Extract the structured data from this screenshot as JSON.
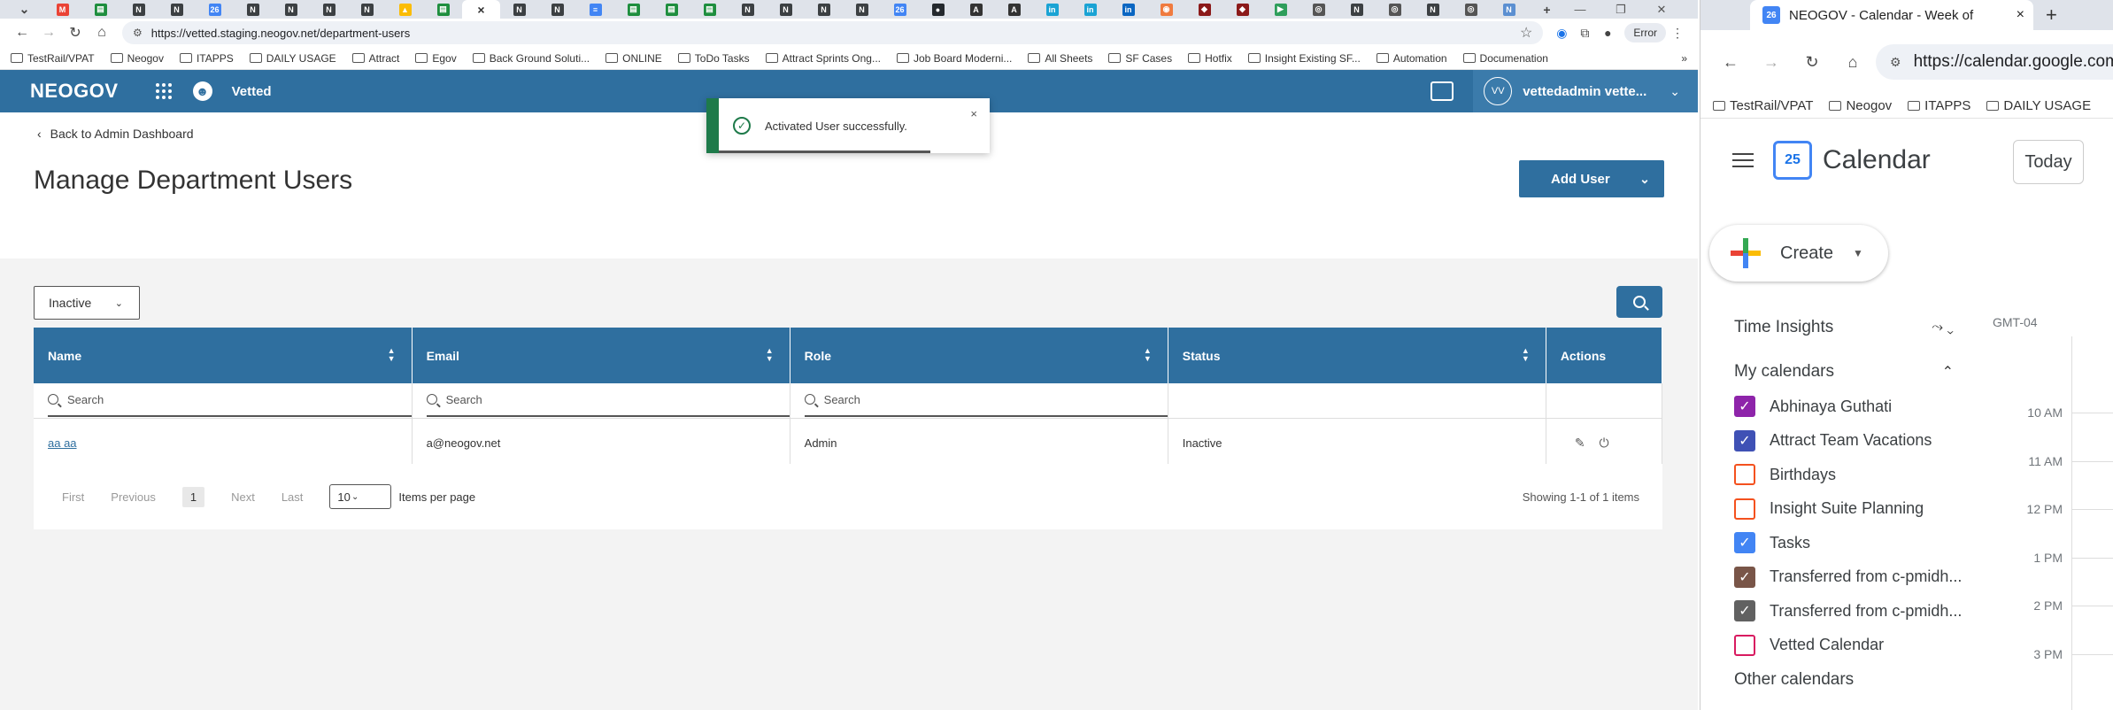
{
  "left_browser": {
    "tab_favicons": [
      {
        "icon": "chevron-down-icon",
        "glyph": "⌄",
        "color": "#dfe3ea"
      },
      {
        "icon": "gmail-icon",
        "glyph": "M",
        "color": "#ea4335"
      },
      {
        "icon": "sheets-icon",
        "glyph": "▤",
        "color": "#1e8e3e"
      },
      {
        "icon": "neogov-icon",
        "glyph": "N",
        "color": "#3c4043"
      },
      {
        "icon": "neogov-icon",
        "glyph": "N",
        "color": "#3c4043"
      },
      {
        "icon": "calendar-icon",
        "glyph": "26",
        "color": "#4285f4"
      },
      {
        "icon": "neogov-icon",
        "glyph": "N",
        "color": "#3c4043"
      },
      {
        "icon": "neogov-icon",
        "glyph": "N",
        "color": "#3c4043"
      },
      {
        "icon": "neogov-icon",
        "glyph": "N",
        "color": "#3c4043"
      },
      {
        "icon": "neogov-icon",
        "glyph": "N",
        "color": "#3c4043"
      },
      {
        "icon": "drive-icon",
        "glyph": "▲",
        "color": "#fbbc04"
      },
      {
        "icon": "sheets-icon",
        "glyph": "▤",
        "color": "#1e8e3e"
      },
      {
        "icon": "close-icon",
        "glyph": "×",
        "color": "#ffffff",
        "active": true
      },
      {
        "icon": "neogov-icon",
        "glyph": "N",
        "color": "#3c4043"
      },
      {
        "icon": "neogov-icon",
        "glyph": "N",
        "color": "#3c4043"
      },
      {
        "icon": "docs-icon",
        "glyph": "≡",
        "color": "#4285f4"
      },
      {
        "icon": "sheets-icon",
        "glyph": "▤",
        "color": "#1e8e3e"
      },
      {
        "icon": "sheets-icon",
        "glyph": "▤",
        "color": "#1e8e3e"
      },
      {
        "icon": "sheets-icon",
        "glyph": "▤",
        "color": "#1e8e3e"
      },
      {
        "icon": "neogov-icon",
        "glyph": "N",
        "color": "#3c4043"
      },
      {
        "icon": "neogov-icon",
        "glyph": "N",
        "color": "#3c4043"
      },
      {
        "icon": "neogov-icon",
        "glyph": "N",
        "color": "#3c4043"
      },
      {
        "icon": "neogov-icon",
        "glyph": "N",
        "color": "#3c4043"
      },
      {
        "icon": "calendar-icon",
        "glyph": "26",
        "color": "#4285f4"
      },
      {
        "icon": "github-icon",
        "glyph": "●",
        "color": "#24292e"
      },
      {
        "icon": "angular-icon",
        "glyph": "A",
        "color": "#333333"
      },
      {
        "icon": "angular-icon",
        "glyph": "A",
        "color": "#333333"
      },
      {
        "icon": "link-icon",
        "glyph": "in",
        "color": "#1aa3d4"
      },
      {
        "icon": "link-icon",
        "glyph": "in",
        "color": "#1aa3d4"
      },
      {
        "icon": "linkedin-icon",
        "glyph": "in",
        "color": "#0a66c2"
      },
      {
        "icon": "jenkins-icon",
        "glyph": "◉",
        "color": "#f07b3f"
      },
      {
        "icon": "elephant-icon",
        "glyph": "◆",
        "color": "#8b1a1a"
      },
      {
        "icon": "elephant-icon",
        "glyph": "◆",
        "color": "#8b1a1a"
      },
      {
        "icon": "play-icon",
        "glyph": "▶",
        "color": "#2e9e5b"
      },
      {
        "icon": "globe-icon",
        "glyph": "◎",
        "color": "#555555"
      },
      {
        "icon": "neogov-icon",
        "glyph": "N",
        "color": "#3c4043"
      },
      {
        "icon": "globe-icon",
        "glyph": "◎",
        "color": "#555555"
      },
      {
        "icon": "neogov-icon",
        "glyph": "N",
        "color": "#3c4043"
      },
      {
        "icon": "globe-icon",
        "glyph": "◎",
        "color": "#555555"
      },
      {
        "icon": "neogov-icon",
        "glyph": "N",
        "color": "#5b8fd1"
      },
      {
        "icon": "plus-icon",
        "glyph": "+",
        "color": "#dfe3ea"
      }
    ],
    "window_controls": [
      "—",
      "❐",
      "✕"
    ],
    "url": "https://vetted.staging.neogov.net/department-users",
    "error_chip": "Error",
    "bookmarks": [
      "TestRail/VPAT",
      "Neogov",
      "ITAPPS",
      "DAILY USAGE",
      "Attract",
      "Egov",
      "Back Ground Soluti...",
      "ONLINE",
      "ToDo Tasks",
      "Attract Sprints Ong...",
      "Job Board Moderni...",
      "All Sheets",
      "SF Cases",
      "Hotfix",
      "Insight Existing SF...",
      "Automation",
      "Documenation"
    ],
    "bookmarks_more": "»"
  },
  "app": {
    "logo": "NEOGOV",
    "app_name": "Vetted",
    "user_initials": "VV",
    "user_name": "vettedadmin vette...",
    "toast": {
      "message": "Activated User successfully.",
      "progress_fraction": 0.78
    },
    "back_link": "Back to Admin Dashboard",
    "page_title": "Manage Department Users",
    "add_user_label": "Add User",
    "status_filter": "Inactive",
    "columns": [
      "Name",
      "Email",
      "Role",
      "Status",
      "Actions"
    ],
    "search_placeholder": "Search",
    "rows": [
      {
        "name": "aa aa",
        "email": "a@neogov.net",
        "role": "Admin",
        "status": "Inactive"
      }
    ],
    "pager": {
      "first": "First",
      "previous": "Previous",
      "page": "1",
      "next": "Next",
      "last": "Last",
      "per_page_value": "10",
      "items_per_page": "Items per page",
      "showing": "Showing 1-1 of 1 items"
    },
    "colors": {
      "header": "#2f6f9f",
      "toast_accent": "#1e7a4a",
      "content_bg": "#f3f3f3"
    }
  },
  "right_browser": {
    "tab_title": "NEOGOV - Calendar - Week of",
    "tab_favicon": "26",
    "url": "https://calendar.google.com/",
    "bookmarks": [
      "TestRail/VPAT",
      "Neogov",
      "ITAPPS",
      "DAILY USAGE"
    ],
    "calendar": {
      "logo_day": "25",
      "title": "Calendar",
      "today_label": "Today",
      "create_label": "Create",
      "time_insights": "Time Insights",
      "my_calendars": "My calendars",
      "items": [
        {
          "name": "Abhinaya Guthati",
          "checked": true,
          "color": "#8e24aa"
        },
        {
          "name": "Attract Team Vacations",
          "checked": true,
          "color": "#3f51b5"
        },
        {
          "name": "Birthdays",
          "checked": false,
          "color": "#f4511e"
        },
        {
          "name": "Insight Suite Planning",
          "checked": false,
          "color": "#f4511e"
        },
        {
          "name": "Tasks",
          "checked": true,
          "color": "#4285f4"
        },
        {
          "name": "Transferred from c-pmidh...",
          "checked": true,
          "color": "#795548"
        },
        {
          "name": "Transferred from c-pmidh...",
          "checked": true,
          "color": "#616161"
        },
        {
          "name": "Vetted Calendar",
          "checked": false,
          "color": "#d81b60"
        }
      ],
      "other_calendars": "Other calendars",
      "timezone": "GMT-04",
      "hours": [
        "10 AM",
        "11 AM",
        "12 PM",
        "1 PM",
        "2 PM",
        "3 PM"
      ]
    }
  }
}
